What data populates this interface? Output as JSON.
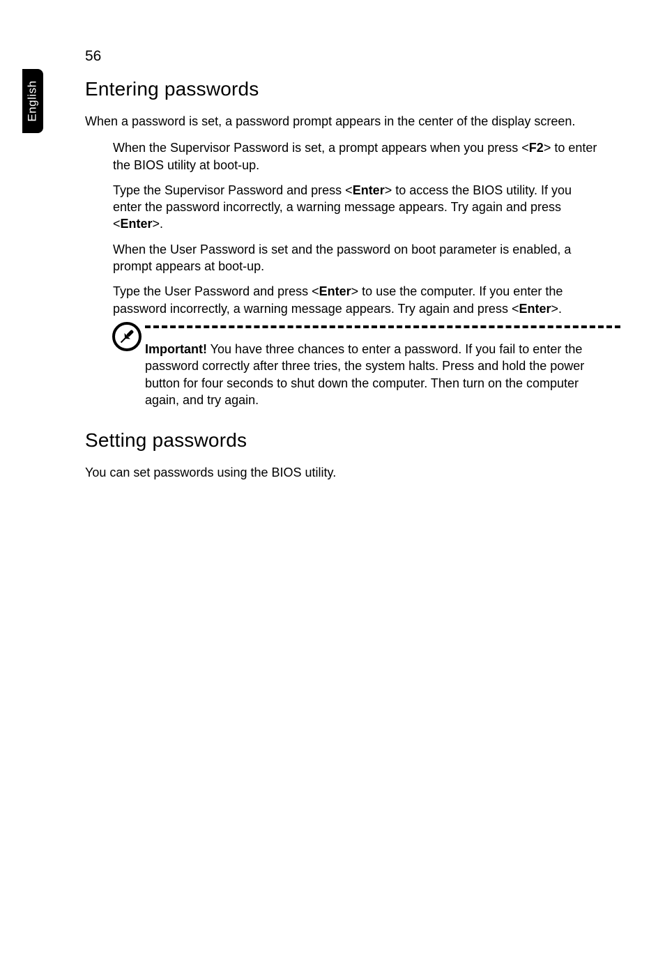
{
  "page_number": "56",
  "side_tab": "English",
  "h1a": "Entering passwords",
  "intro": "When a password is set, a password prompt appears in the center of the display screen.",
  "bullets": [
    {
      "pre": "When the Supervisor Password is set, a prompt appears when you press <",
      "b1": "F2",
      "post": "> to enter the BIOS utility at boot-up."
    },
    {
      "pre": "Type the Supervisor Password and press <",
      "b1": "Enter",
      "mid": "> to access the BIOS utility. If you enter the password incorrectly, a warning message appears. Try again and press <",
      "b2": "Enter",
      "post": ">."
    },
    {
      "pre": "When the User Password is set and the password on boot parameter is enabled, a prompt appears at boot-up."
    },
    {
      "pre": "Type the User Password and press <",
      "b1": "Enter",
      "mid": "> to use the computer. If you enter the password incorrectly, a warning message appears. Try again and press <",
      "b2": "Enter",
      "post": ">."
    }
  ],
  "note": {
    "label": "Important!",
    "text": " You have three chances to enter a password. If you fail to enter the password correctly after three tries, the system halts. Press and hold the power button for four seconds to shut down the computer. Then turn on the computer again, and try again."
  },
  "h1b": "Setting passwords",
  "outro": "You can set passwords using the BIOS utility."
}
